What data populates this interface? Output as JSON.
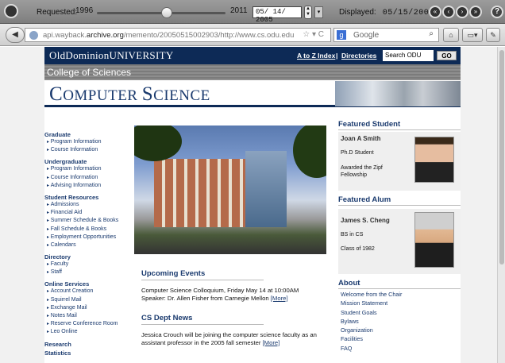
{
  "wayback": {
    "requested_label": "Requested:",
    "year_start": "1996",
    "year_end": "2011",
    "date_field": "05/ 14/ 2005",
    "displayed_label": "Displayed:",
    "displayed_date": "05/15/2005"
  },
  "browser": {
    "url_pre": "api.wayback.",
    "url_host": "archive.org",
    "url_post": "/memento/20050515002903/http://www.cs.odu.edu",
    "search_placeholder": "Google"
  },
  "site": {
    "university": "OldDominionUNIVERSITY",
    "a_to_z": "A to Z Index",
    "directories": "Directories",
    "search_value": "Search ODU",
    "go": "GO",
    "college": "College of Sciences",
    "dept_big1": "C",
    "dept_small1": "OMPUTER ",
    "dept_big2": "S",
    "dept_small2": "CIENCE"
  },
  "sidebar": {
    "graduate": "Graduate",
    "g1": "Program Information",
    "g2": "Course Information",
    "undergraduate": "Undergraduate",
    "u1": "Program Information",
    "u2": "Course Information",
    "u3": "Advising Information",
    "student_resources": "Student Resources",
    "s1": "Admissions",
    "s2": "Financial Aid",
    "s3": "Summer Schedule & Books",
    "s4": "Fall Schedule & Books",
    "s5": "Employment Opportunities",
    "s6": "Calendars",
    "directory": "Directory",
    "d1": "Faculty",
    "d2": "Staff",
    "online_services": "Online Services",
    "o1": "Account Creation",
    "o2": "Squirrel Mail",
    "o3": "Exchange Mail",
    "o4": "Notes Mail",
    "o5": "Reserve Conference Room",
    "o6": "Leo Online",
    "research": "Research",
    "statistics": "Statistics"
  },
  "events": {
    "title": "Upcoming Events",
    "line1": "Computer Science Colloquium, Friday May 14 at 10:00AM",
    "line2": "Speaker: Dr. Allen Fisher from Carnegie Mellon ",
    "more": "[More]"
  },
  "news": {
    "title": "CS Dept News",
    "line1": "Jessica Crouch will be joining the computer science faculty as an",
    "line2": "assistant professor in the 2005 fall semester ",
    "more": "[More]"
  },
  "featured_student": {
    "title": "Featured Student",
    "name": "Joan A Smith",
    "degree": "Ph.D Student",
    "award1": "Awarded the Zipf",
    "award2": "Fellowship"
  },
  "featured_alum": {
    "title": "Featured Alum",
    "name": "James S. Cheng",
    "degree": "BS in CS",
    "class": "Class of 1982"
  },
  "about": {
    "title": "About",
    "items": [
      "Welcome from the Chair",
      "Mission Statement",
      "Student Goals",
      "Bylaws",
      "Organization",
      "Facilities",
      "FAQ"
    ]
  }
}
